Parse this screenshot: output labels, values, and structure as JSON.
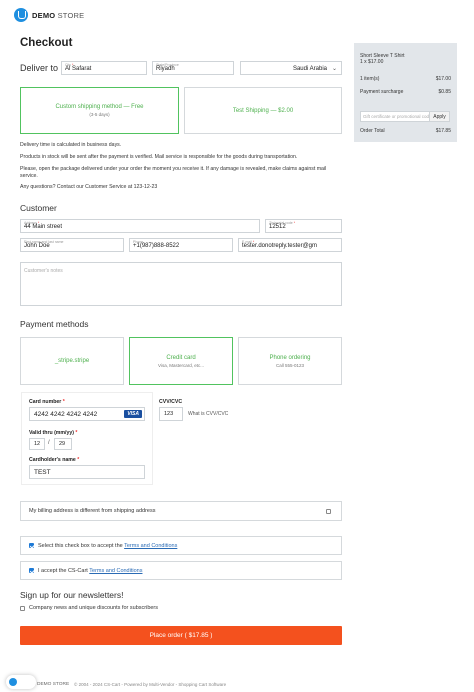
{
  "brand": {
    "name_bold": "DEMO",
    "name_rest": " STORE",
    "accent": "#1e8fe0"
  },
  "page_title": "Checkout",
  "deliver": {
    "label": "Deliver to",
    "city_label": "City",
    "city_value": "Al Safarat",
    "state_label": "State/Province",
    "state_value": "Riyadh",
    "country_value": "Saudi Arabia"
  },
  "shipping": [
    {
      "name": "Custom shipping method — Free",
      "sub": "(3-5 days)",
      "active": true
    },
    {
      "name": "Test Shipping — $2.00",
      "sub": "",
      "active": false
    }
  ],
  "info_lines": [
    "Delivery time is calculated in business days.",
    "Products in stock will be sent after the payment is verified. Mail service is responsible for the goods during transportation.",
    "Please, open the package delivered under your order the moment you receive it. If any damage is revealed, make claims against mail service.",
    "Any questions? Contact our Customer Service at 123-12-23"
  ],
  "customer": {
    "title": "Customer",
    "address_label": "Address",
    "address_value": "44 Main street",
    "zip_label": "Zip/postal code",
    "zip_value": "12512",
    "name_label": "First name and last name",
    "name_value": "John Doe",
    "phone_label": "Phone",
    "phone_value": "+1(987)888-8522",
    "email_label": "E-mail",
    "email_value": "tester.donotreply.tester@gm",
    "notes_placeholder": "Customer's notes"
  },
  "payment": {
    "title": "Payment methods",
    "methods": [
      {
        "name": "_stripe.stripe",
        "sub": "",
        "active": false
      },
      {
        "name": "Credit card",
        "sub": "Visa, Mastercard, etc...",
        "active": true
      },
      {
        "name": "Phone ordering",
        "sub": "Call 555-0123",
        "active": false
      }
    ],
    "card_number_label": "Card number",
    "card_number_value": "4242 4242 4242 4242",
    "card_brand": "VISA",
    "valid_label": "Valid thru (mm/yy)",
    "month": "12",
    "year": "29",
    "slash": "/",
    "cvv_label": "CVV/CVC",
    "cvv_value": "123",
    "cvv_help": "What is CVV/CVC",
    "holder_label": "Cardholder's name",
    "holder_value": "TEST"
  },
  "billing_diff_label": "My billing address is different from shipping address",
  "terms": {
    "accept_prefix": "Select this check box to accept the ",
    "accept_link": "Terms and Conditions",
    "cscart_prefix": "I accept the CS-Cart ",
    "cscart_link": "Terms and Conditions"
  },
  "newsletter": {
    "title": "Sign up for our newsletters!",
    "option": "Company news and unique discounts for subscribers"
  },
  "place_order": "Place order ( $17.85 )",
  "sidebar": {
    "product_name": "Short Sleeve T Shirt",
    "product_qty": "1 x $17.00",
    "items_label": "1 item(s)",
    "items_value": "$17.00",
    "surcharge_label": "Payment surcharge",
    "surcharge_value": "$0.85",
    "promo_placeholder": "Gift certificate or promotional code",
    "apply_label": "Apply",
    "total_label": "Order Total",
    "total_value": "$17.85"
  },
  "footer": {
    "brand": "DEMO STORE",
    "text": "© 2004 - 2024 CS-Cart - Powered by Multi-Vendor - Shopping Cart Software"
  }
}
